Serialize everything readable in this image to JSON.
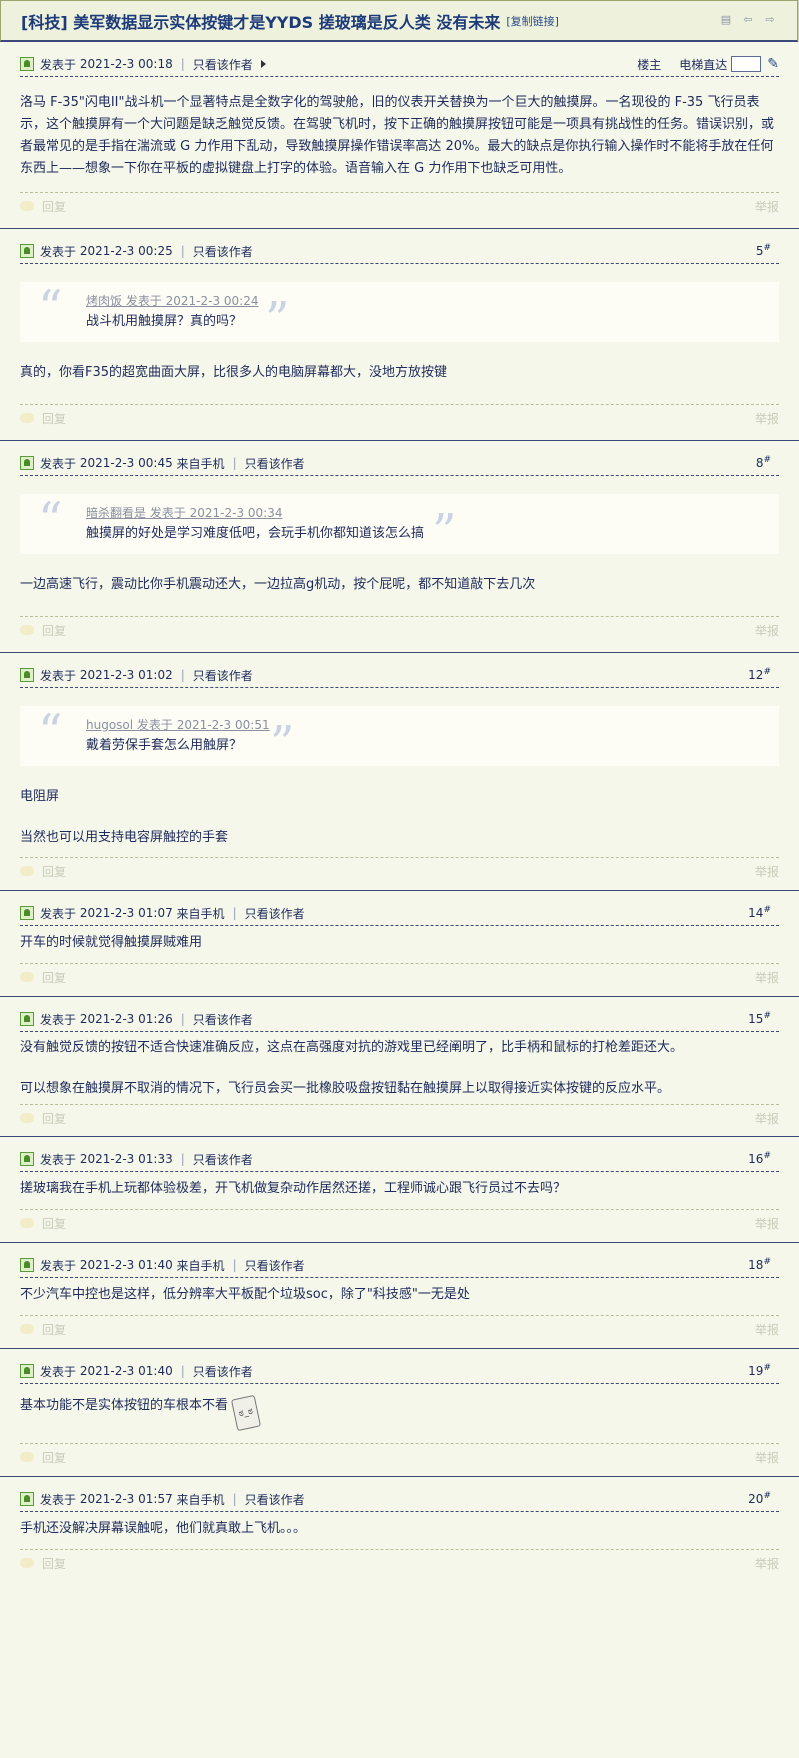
{
  "thread": {
    "title": "[科技] 美军数据显示实体按键才是YYDS 搓玻璃是反人类 没有未来",
    "copy_link": "[复制链接]"
  },
  "labels": {
    "posted_prefix": "发表于",
    "from_mobile": "来自手机",
    "only_author": "只看该作者",
    "op": "楼主",
    "elevator": "电梯直达",
    "reply": "回复",
    "report": "举报"
  },
  "posts": [
    {
      "time": "2021-2-3 00:18",
      "floor": "",
      "content": [
        "洛马 F-35\"闪电II\"战斗机一个显著特点是全数字化的驾驶舱，旧的仪表开关替换为一个巨大的触摸屏。一名现役的 F-35 飞行员表示，这个触摸屏有一个大问题是缺乏触觉反馈。在驾驶飞机时，按下正确的触摸屏按钮可能是一项具有挑战性的任务。错误识别，或者最常见的是手指在湍流或 G 力作用下乱动，导致触摸屏操作错误率高达 20%。最大的缺点是你执行输入操作时不能将手放在任何东西上——想象一下你在平板的虚拟键盘上打字的体验。语音输入在 G 力作用下也缺乏可用性。"
      ]
    },
    {
      "time": "2021-2-3 00:25",
      "floor": "5",
      "quote_author": "烤肉饭 发表于 2021-2-3 00:24",
      "quote_text": "战斗机用触摸屏？真的吗？",
      "content": [
        "真的，你看F35的超宽曲面大屏，比很多人的电脑屏幕都大，没地方放按键"
      ]
    },
    {
      "time": "2021-2-3 00:45",
      "floor": "8",
      "quote_author": "暗杀翻看是 发表于 2021-2-3 00:34",
      "quote_text": "触摸屏的好处是学习难度低吧，会玩手机你都知道该怎么搞",
      "content": [
        "一边高速飞行，震动比你手机震动还大，一边拉高g机动，按个屁呢，都不知道敲下去几次"
      ]
    },
    {
      "time": "2021-2-3 01:02",
      "floor": "12",
      "quote_author": "hugosol 发表于 2021-2-3 00:51",
      "quote_text": "戴着劳保手套怎么用触屏？",
      "content": [
        "电阻屏",
        "当然也可以用支持电容屏触控的手套"
      ]
    },
    {
      "time": "2021-2-3 01:07",
      "floor": "14",
      "content": [
        "开车的时候就觉得触摸屏贼难用"
      ]
    },
    {
      "time": "2021-2-3 01:26",
      "floor": "15",
      "content": [
        "没有触觉反馈的按钮不适合快速准确反应，这点在高强度对抗的游戏里已经阐明了，比手柄和鼠标的打枪差距还大。",
        "可以想象在触摸屏不取消的情况下，飞行员会买一批橡胶吸盘按钮黏在触摸屏上以取得接近实体按键的反应水平。"
      ]
    },
    {
      "time": "2021-2-3 01:33",
      "floor": "16",
      "content": [
        "搓玻璃我在手机上玩都体验极差，开飞机做复杂动作居然还搓，工程师诚心跟飞行员过不去吗？"
      ]
    },
    {
      "time": "2021-2-3 01:40",
      "floor": "18",
      "content": [
        "不少汽车中控也是这样，低分辨率大平板配个垃圾soc，除了\"科技感\"一无是处"
      ]
    },
    {
      "time": "2021-2-3 01:40",
      "floor": "19",
      "content": [
        "基本功能不是实体按钮的车根本不看"
      ]
    },
    {
      "time": "2021-2-3 01:57",
      "floor": "20",
      "content": [
        "手机还没解决屏幕误触呢，他们就真敢上飞机。。。"
      ]
    }
  ]
}
